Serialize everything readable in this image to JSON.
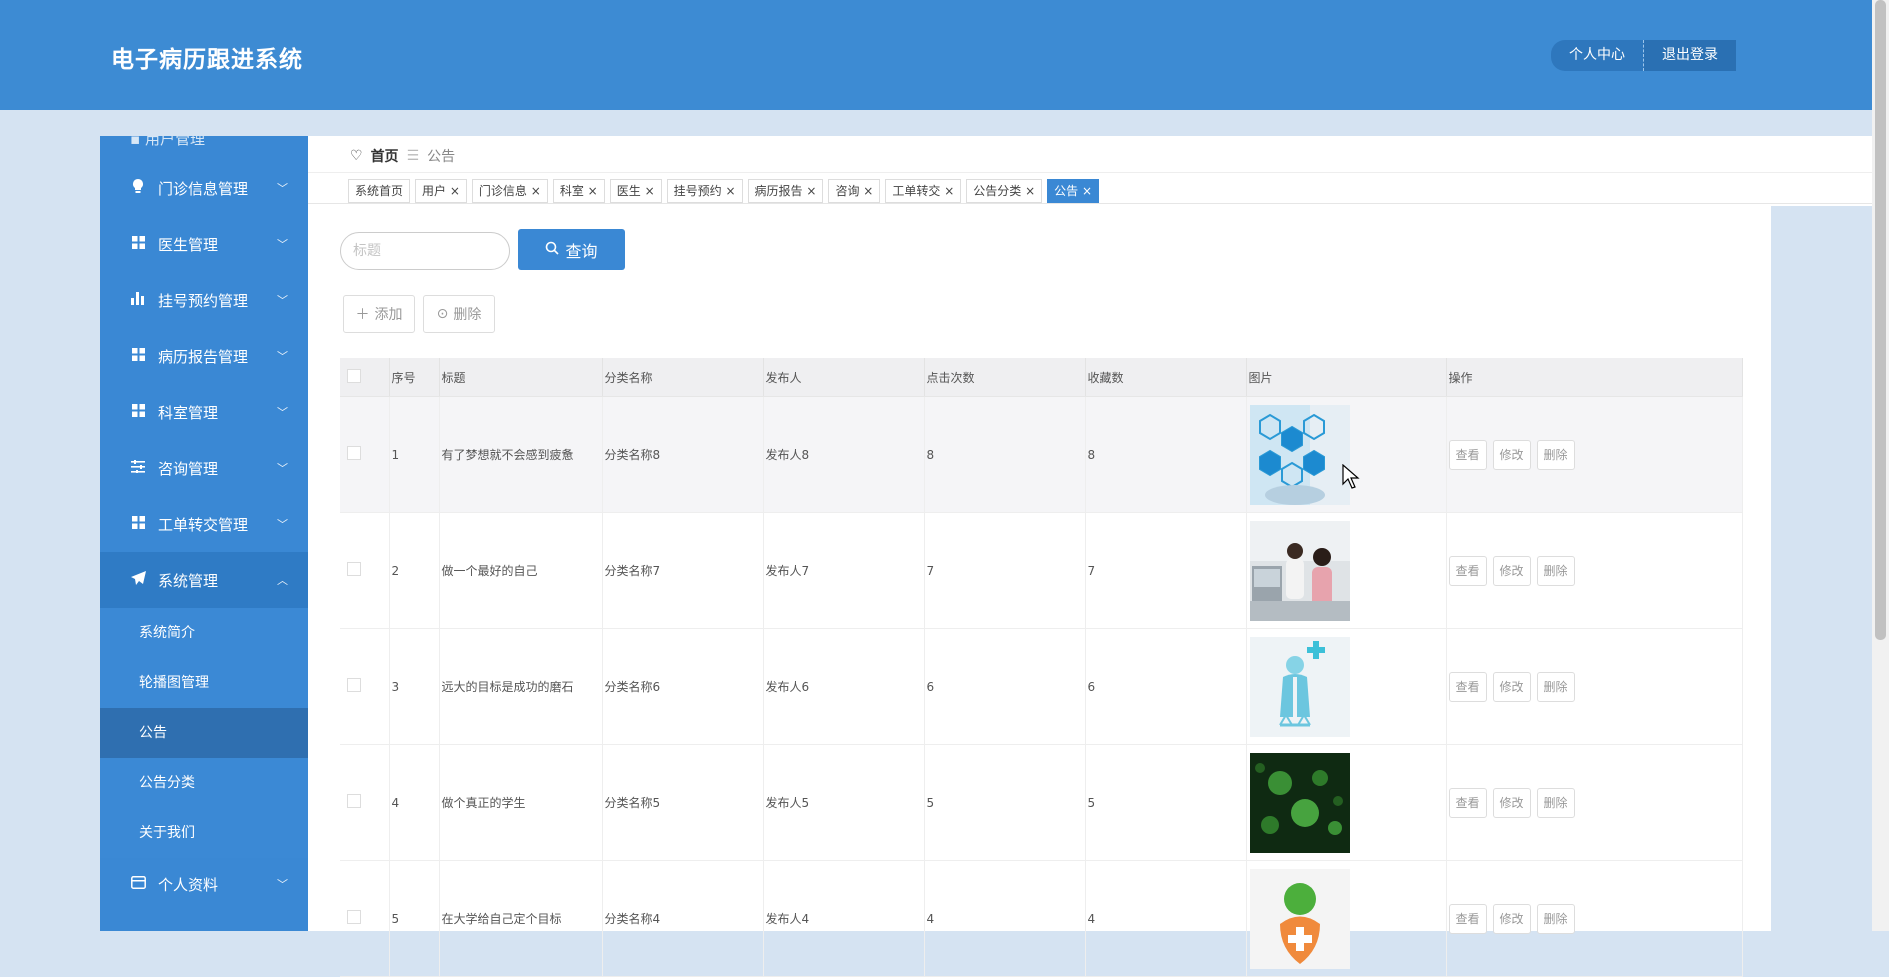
{
  "header": {
    "app_title": "电子病历跟进系统",
    "personal_center": "个人中心",
    "logout": "退出登录"
  },
  "sidebar": {
    "partial_top": "用户管理",
    "items": [
      {
        "label": "门诊信息管理",
        "icon": "lightbulb-icon"
      },
      {
        "label": "医生管理",
        "icon": "grid-icon"
      },
      {
        "label": "挂号预约管理",
        "icon": "bar-chart-icon"
      },
      {
        "label": "病历报告管理",
        "icon": "grid-icon"
      },
      {
        "label": "科室管理",
        "icon": "grid-icon"
      },
      {
        "label": "咨询管理",
        "icon": "sliders-icon"
      },
      {
        "label": "工单转交管理",
        "icon": "grid-icon"
      },
      {
        "label": "系统管理",
        "icon": "paper-plane-icon"
      }
    ],
    "sub_items": [
      "系统简介",
      "轮播图管理",
      "公告",
      "公告分类",
      "关于我们"
    ],
    "profile": "个人资料"
  },
  "breadcrumb": {
    "home": "首页",
    "current": "公告"
  },
  "tags": [
    "系统首页",
    "用户",
    "门诊信息",
    "科室",
    "医生",
    "挂号预约",
    "病历报告",
    "咨询",
    "工单转交",
    "公告分类",
    "公告"
  ],
  "search": {
    "placeholder": "标题",
    "button": "查询"
  },
  "actions": {
    "add": "添加",
    "delete": "删除"
  },
  "table": {
    "headers": [
      "序号",
      "标题",
      "分类名称",
      "发布人",
      "点击次数",
      "收藏数",
      "图片",
      "操作"
    ],
    "rows": [
      {
        "no": "1",
        "title": "有了梦想就不会感到疲惫",
        "category": "分类名称8",
        "publisher": "发布人8",
        "clicks": "8",
        "favorites": "8",
        "image": "medical-icons-image"
      },
      {
        "no": "2",
        "title": "做一个最好的自己",
        "category": "分类名称7",
        "publisher": "发布人7",
        "clicks": "7",
        "favorites": "7",
        "image": "doctor-patient-photo"
      },
      {
        "no": "3",
        "title": "远大的目标是成功的磨石",
        "category": "分类名称6",
        "publisher": "发布人6",
        "clicks": "6",
        "favorites": "6",
        "image": "doctor-illustration"
      },
      {
        "no": "4",
        "title": "做个真正的学生",
        "category": "分类名称5",
        "publisher": "发布人5",
        "clicks": "5",
        "favorites": "5",
        "image": "virus-image"
      },
      {
        "no": "5",
        "title": "在大学给自己定个目标",
        "category": "分类名称4",
        "publisher": "发布人4",
        "clicks": "4",
        "favorites": "4",
        "image": "health-heart-image"
      }
    ],
    "ops": {
      "view": "查看",
      "edit": "修改",
      "delete": "删除"
    }
  },
  "colors": {
    "primary": "#3a88d4",
    "header": "#3d8bd3",
    "sidebar": "#3a88d4"
  }
}
